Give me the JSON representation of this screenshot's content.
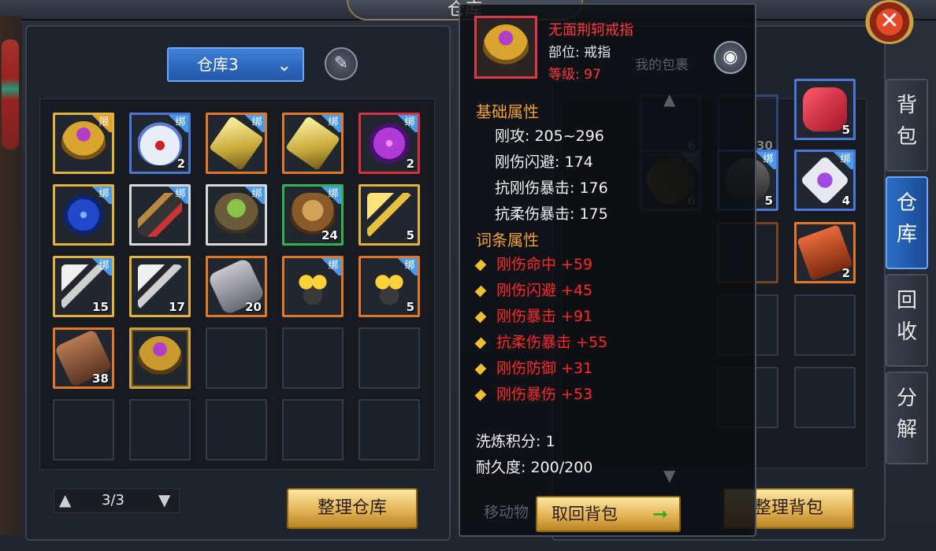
{
  "window": {
    "title": "仓库"
  },
  "warehouse": {
    "selector_label": "仓库3",
    "pager": {
      "text": "3/3"
    },
    "sort_button": "整理仓库",
    "slots": [
      {
        "icon": "ring-icon",
        "tag": "限",
        "qty": ""
      },
      {
        "icon": "vase-icon",
        "tag": "绑",
        "qty": "2"
      },
      {
        "icon": "crystal-icon",
        "tag": "绑",
        "qty": ""
      },
      {
        "icon": "crystal-icon",
        "tag": "绑",
        "qty": ""
      },
      {
        "icon": "purple-orb-icon",
        "tag": "绑",
        "qty": "2"
      },
      {
        "icon": "blue-orb-icon",
        "tag": "绑",
        "qty": ""
      },
      {
        "icon": "tool-icon",
        "tag": "绑",
        "qty": ""
      },
      {
        "icon": "pot-icon",
        "tag": "绑",
        "qty": ""
      },
      {
        "icon": "basket-icon",
        "tag": "绑",
        "qty": "24"
      },
      {
        "icon": "gold-key-icon",
        "tag": "",
        "qty": "5"
      },
      {
        "icon": "silver-key-icon",
        "tag": "绑",
        "qty": "15"
      },
      {
        "icon": "silver-key-icon",
        "tag": "",
        "qty": "17"
      },
      {
        "icon": "plate-icon",
        "tag": "",
        "qty": "20"
      },
      {
        "icon": "chain-icon",
        "tag": "绑",
        "qty": ""
      },
      {
        "icon": "chain-icon",
        "tag": "绑",
        "qty": "5"
      },
      {
        "icon": "board-icon",
        "tag": "",
        "qty": "38"
      },
      {
        "icon": "ring-icon",
        "tag": "",
        "qty": ""
      }
    ]
  },
  "bag": {
    "title_ghost": "我的包裹",
    "sort_button": "整理背包",
    "slots": [
      {
        "qty": "6"
      },
      {
        "qty": "30"
      },
      {
        "qty": "5",
        "icon": "red-gem-icon"
      },
      {
        "qty": "6",
        "tag": "绑"
      },
      {
        "qty": "5",
        "tag": "绑"
      },
      {
        "qty": "4",
        "tag": "绑",
        "icon": "purple-card-icon"
      },
      {
        "qty": "2",
        "icon": "book-icon"
      }
    ]
  },
  "side_tabs": [
    "背\n包",
    "仓\n库",
    "回\n收",
    "分\n解"
  ],
  "tooltip": {
    "name": "无面荆轲戒指",
    "slot": "部位: 戒指",
    "level": "等级: 97",
    "base_header": "基础属性",
    "base_stats": [
      "刚攻: 205~296",
      "刚伤闪避: 174",
      "抗刚伤暴击: 176",
      "抗柔伤暴击: 175"
    ],
    "affix_header": "词条属性",
    "affixes": [
      "刚伤命中 +59",
      "刚伤闪避 +45",
      "刚伤暴击 +91",
      "抗柔伤暴击 +55",
      "刚伤防御 +31",
      "刚伤暴伤 +53"
    ],
    "refine": "洗炼积分: 1",
    "durability": "耐久度: 200/200",
    "ghost_move": "移动物",
    "retrieve_button": "取回背包"
  },
  "colors": {
    "accent_blue": "#2c6fc8",
    "rare_red": "#ff3c3c",
    "header_orange": "#f0a030"
  }
}
